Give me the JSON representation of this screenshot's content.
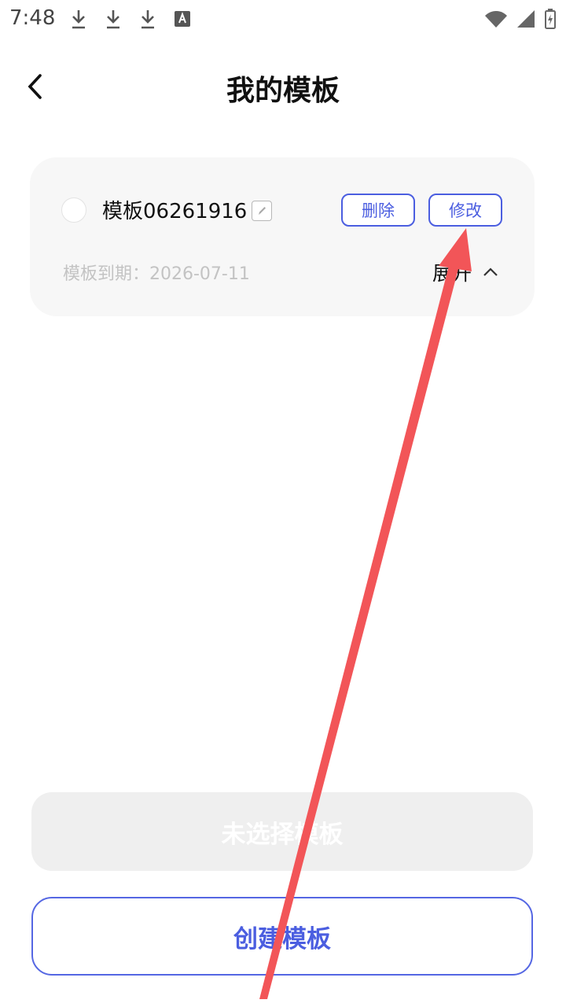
{
  "status_bar": {
    "time": "7:48",
    "left_icons": [
      "download-icon",
      "download-icon",
      "download-icon",
      "font-icon"
    ],
    "right_icons": [
      "wifi-icon",
      "signal-icon",
      "battery-charging-icon"
    ]
  },
  "header": {
    "title": "我的模板",
    "back_icon": "chevron-left-icon"
  },
  "template_card": {
    "name": "模板06261916",
    "delete_label": "删除",
    "modify_label": "修改",
    "expiry": "模板到期：2026-07-11",
    "expand_label": "展开",
    "selected": false
  },
  "actions": {
    "selection_status": "未选择模板",
    "create_label": "创建模板"
  },
  "colors": {
    "accent": "#4b5ee0",
    "card_bg": "#f7f7f7",
    "muted_text": "#c3c3c3",
    "annotation_arrow": "#f25558"
  }
}
